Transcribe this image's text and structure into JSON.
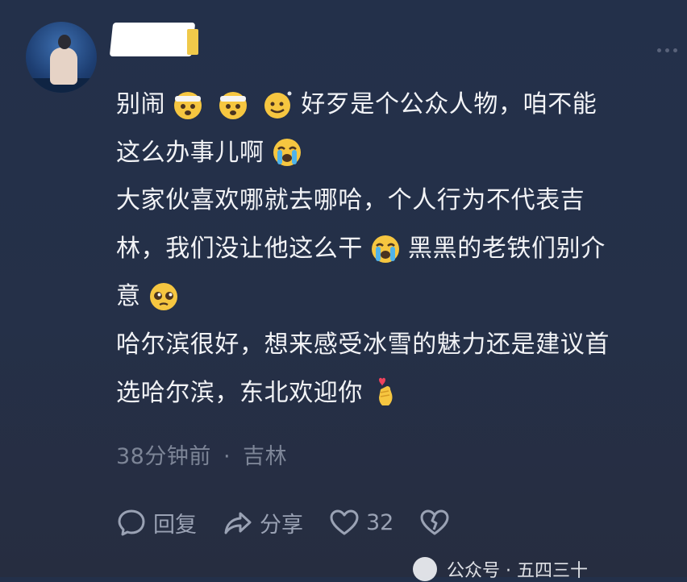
{
  "comment": {
    "lines": [
      [
        "别闹",
        "",
        "好歹是个公众人物，咱不能"
      ],
      [
        "这么办事儿啊"
      ],
      [
        "大家伙喜欢哪就去哪哈，个人行为不代表吉"
      ],
      [
        "林，我们没让他这么干",
        "黑黑的老铁们别介"
      ],
      [
        "意"
      ],
      [
        "哈尔滨很好，想来感受冰雪的魅力还是建议首"
      ],
      [
        "选哈尔滨，东北欢迎你"
      ]
    ]
  },
  "meta": {
    "time": "38分钟前",
    "separator": "·",
    "location": "吉林"
  },
  "actions": {
    "reply": "回复",
    "share": "分享",
    "likes": "32"
  },
  "watermark": {
    "text": "公众号 · 五四三十"
  },
  "icons": {
    "emoji_a": "face-with-head-bandage-icon",
    "emoji_b": "smiling-face-icon",
    "emoji_c": "loudly-crying-face-icon",
    "emoji_d": "pleading-face-icon",
    "emoji_e": "hand-with-heart-icon"
  },
  "colors": {
    "background": "#253048",
    "text": "#f2f3f6",
    "meta": "#7d8597",
    "accent_emoji": "#f6c640"
  }
}
